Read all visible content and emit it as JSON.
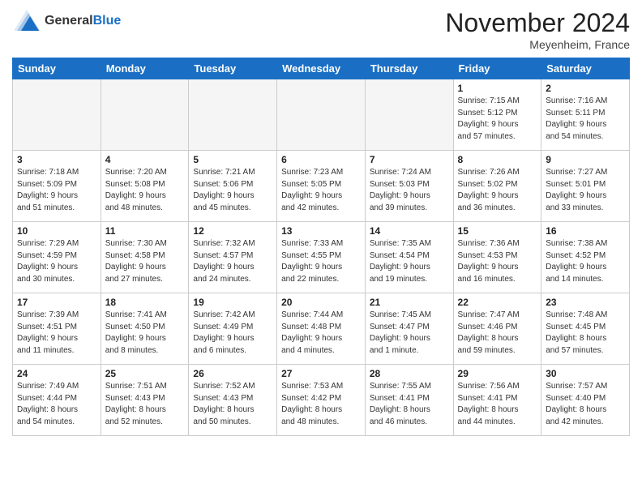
{
  "header": {
    "logo_general": "General",
    "logo_blue": "Blue",
    "month": "November 2024",
    "location": "Meyenheim, France"
  },
  "weekdays": [
    "Sunday",
    "Monday",
    "Tuesday",
    "Wednesday",
    "Thursday",
    "Friday",
    "Saturday"
  ],
  "weeks": [
    [
      {
        "day": "",
        "info": ""
      },
      {
        "day": "",
        "info": ""
      },
      {
        "day": "",
        "info": ""
      },
      {
        "day": "",
        "info": ""
      },
      {
        "day": "",
        "info": ""
      },
      {
        "day": "1",
        "info": "Sunrise: 7:15 AM\nSunset: 5:12 PM\nDaylight: 9 hours\nand 57 minutes."
      },
      {
        "day": "2",
        "info": "Sunrise: 7:16 AM\nSunset: 5:11 PM\nDaylight: 9 hours\nand 54 minutes."
      }
    ],
    [
      {
        "day": "3",
        "info": "Sunrise: 7:18 AM\nSunset: 5:09 PM\nDaylight: 9 hours\nand 51 minutes."
      },
      {
        "day": "4",
        "info": "Sunrise: 7:20 AM\nSunset: 5:08 PM\nDaylight: 9 hours\nand 48 minutes."
      },
      {
        "day": "5",
        "info": "Sunrise: 7:21 AM\nSunset: 5:06 PM\nDaylight: 9 hours\nand 45 minutes."
      },
      {
        "day": "6",
        "info": "Sunrise: 7:23 AM\nSunset: 5:05 PM\nDaylight: 9 hours\nand 42 minutes."
      },
      {
        "day": "7",
        "info": "Sunrise: 7:24 AM\nSunset: 5:03 PM\nDaylight: 9 hours\nand 39 minutes."
      },
      {
        "day": "8",
        "info": "Sunrise: 7:26 AM\nSunset: 5:02 PM\nDaylight: 9 hours\nand 36 minutes."
      },
      {
        "day": "9",
        "info": "Sunrise: 7:27 AM\nSunset: 5:01 PM\nDaylight: 9 hours\nand 33 minutes."
      }
    ],
    [
      {
        "day": "10",
        "info": "Sunrise: 7:29 AM\nSunset: 4:59 PM\nDaylight: 9 hours\nand 30 minutes."
      },
      {
        "day": "11",
        "info": "Sunrise: 7:30 AM\nSunset: 4:58 PM\nDaylight: 9 hours\nand 27 minutes."
      },
      {
        "day": "12",
        "info": "Sunrise: 7:32 AM\nSunset: 4:57 PM\nDaylight: 9 hours\nand 24 minutes."
      },
      {
        "day": "13",
        "info": "Sunrise: 7:33 AM\nSunset: 4:55 PM\nDaylight: 9 hours\nand 22 minutes."
      },
      {
        "day": "14",
        "info": "Sunrise: 7:35 AM\nSunset: 4:54 PM\nDaylight: 9 hours\nand 19 minutes."
      },
      {
        "day": "15",
        "info": "Sunrise: 7:36 AM\nSunset: 4:53 PM\nDaylight: 9 hours\nand 16 minutes."
      },
      {
        "day": "16",
        "info": "Sunrise: 7:38 AM\nSunset: 4:52 PM\nDaylight: 9 hours\nand 14 minutes."
      }
    ],
    [
      {
        "day": "17",
        "info": "Sunrise: 7:39 AM\nSunset: 4:51 PM\nDaylight: 9 hours\nand 11 minutes."
      },
      {
        "day": "18",
        "info": "Sunrise: 7:41 AM\nSunset: 4:50 PM\nDaylight: 9 hours\nand 8 minutes."
      },
      {
        "day": "19",
        "info": "Sunrise: 7:42 AM\nSunset: 4:49 PM\nDaylight: 9 hours\nand 6 minutes."
      },
      {
        "day": "20",
        "info": "Sunrise: 7:44 AM\nSunset: 4:48 PM\nDaylight: 9 hours\nand 4 minutes."
      },
      {
        "day": "21",
        "info": "Sunrise: 7:45 AM\nSunset: 4:47 PM\nDaylight: 9 hours\nand 1 minute."
      },
      {
        "day": "22",
        "info": "Sunrise: 7:47 AM\nSunset: 4:46 PM\nDaylight: 8 hours\nand 59 minutes."
      },
      {
        "day": "23",
        "info": "Sunrise: 7:48 AM\nSunset: 4:45 PM\nDaylight: 8 hours\nand 57 minutes."
      }
    ],
    [
      {
        "day": "24",
        "info": "Sunrise: 7:49 AM\nSunset: 4:44 PM\nDaylight: 8 hours\nand 54 minutes."
      },
      {
        "day": "25",
        "info": "Sunrise: 7:51 AM\nSunset: 4:43 PM\nDaylight: 8 hours\nand 52 minutes."
      },
      {
        "day": "26",
        "info": "Sunrise: 7:52 AM\nSunset: 4:43 PM\nDaylight: 8 hours\nand 50 minutes."
      },
      {
        "day": "27",
        "info": "Sunrise: 7:53 AM\nSunset: 4:42 PM\nDaylight: 8 hours\nand 48 minutes."
      },
      {
        "day": "28",
        "info": "Sunrise: 7:55 AM\nSunset: 4:41 PM\nDaylight: 8 hours\nand 46 minutes."
      },
      {
        "day": "29",
        "info": "Sunrise: 7:56 AM\nSunset: 4:41 PM\nDaylight: 8 hours\nand 44 minutes."
      },
      {
        "day": "30",
        "info": "Sunrise: 7:57 AM\nSunset: 4:40 PM\nDaylight: 8 hours\nand 42 minutes."
      }
    ]
  ]
}
